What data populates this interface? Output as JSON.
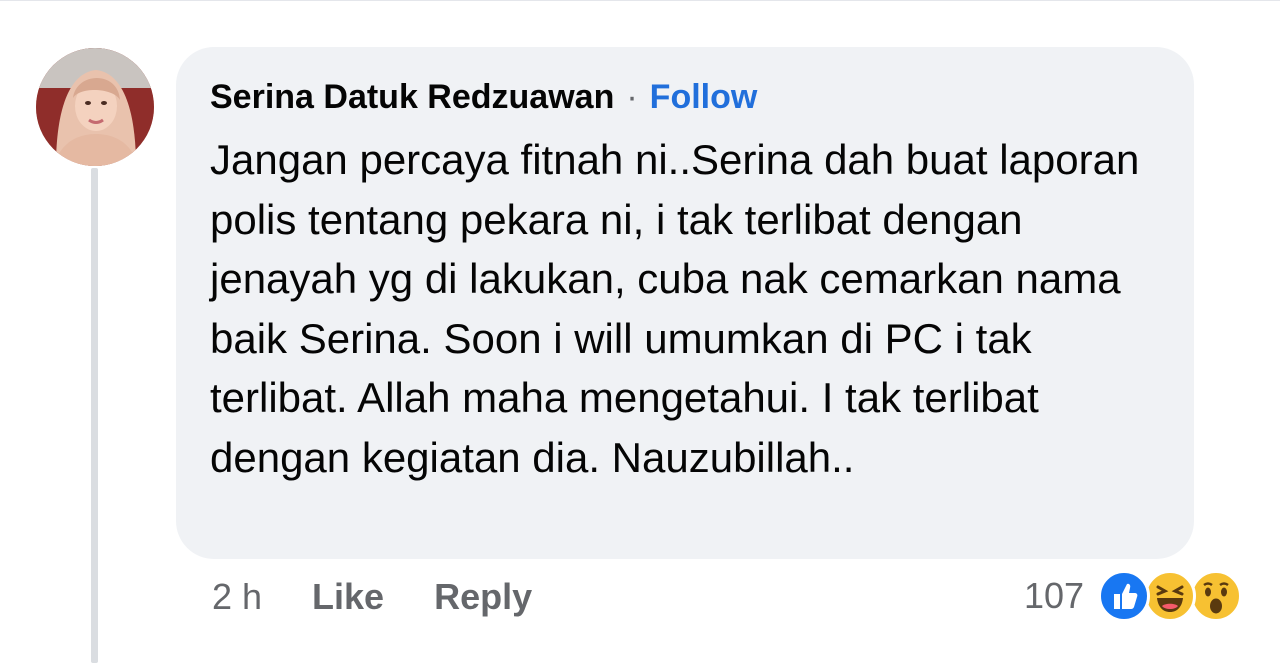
{
  "comment": {
    "author": "Serina Datuk Redzuawan",
    "separator": "·",
    "follow_label": "Follow",
    "text": "Jangan percaya fitnah ni..Serina dah buat laporan polis tentang pekara ni, i tak terlibat dengan jenayah yg di lakukan, cuba nak cemarkan nama baik Serina. Soon i will umumkan di PC i tak terlibat. Allah maha mengetahui. I tak terlibat dengan kegiatan dia. Nauzubillah..",
    "time": "2 h",
    "like_label": "Like",
    "reply_label": "Reply",
    "reaction_count": "107",
    "reactions": [
      "like-icon",
      "haha-icon",
      "wow-icon"
    ]
  },
  "colors": {
    "bubble": "#f0f2f5",
    "follow": "#216fdb",
    "secondary_text": "#65676b",
    "like_blue": "#1877f2",
    "emoji_yellow": "#f7c132"
  }
}
